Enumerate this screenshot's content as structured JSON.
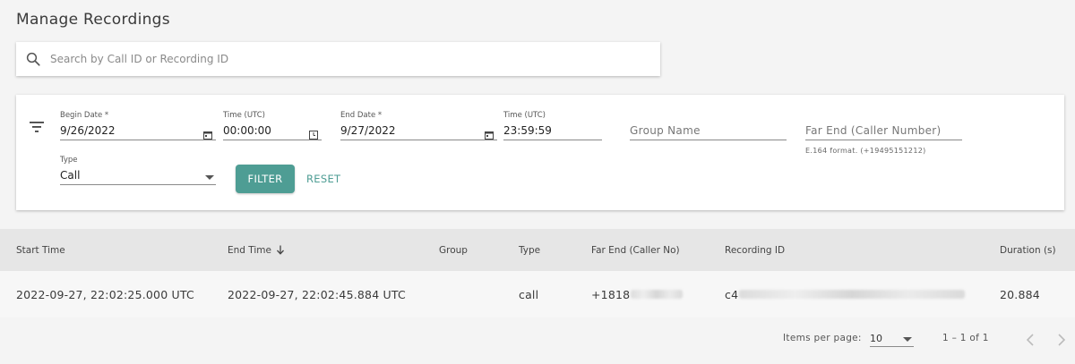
{
  "page": {
    "title": "Manage Recordings"
  },
  "search": {
    "placeholder": "Search by Call ID or Recording ID",
    "value": ""
  },
  "filters": {
    "begin_date": {
      "label": "Begin Date *",
      "value": "9/26/2022"
    },
    "begin_time": {
      "label": "Time (UTC)",
      "value": "00:00:00"
    },
    "end_date": {
      "label": "End Date *",
      "value": "9/27/2022"
    },
    "end_time": {
      "label": "Time (UTC)",
      "value": "23:59:59"
    },
    "group_name": {
      "placeholder": "Group Name",
      "value": ""
    },
    "far_end": {
      "placeholder": "Far End (Caller Number)",
      "hint": "E.164 format. (+19495151212)",
      "value": ""
    },
    "type": {
      "label": "Type",
      "value": "Call"
    },
    "filter_label": "FILTER",
    "reset_label": "RESET"
  },
  "table": {
    "columns": [
      "Start Time",
      "End Time",
      "Group",
      "Type",
      "Far End (Caller No)",
      "Recording ID",
      "Duration (s)"
    ],
    "sort": {
      "column": "End Time",
      "direction": "descending"
    },
    "rows": [
      {
        "start_time": "2022-09-27, 22:02:25.000 UTC",
        "end_time": "2022-09-27, 22:02:45.884 UTC",
        "group": "",
        "type": "call",
        "far_end": "+1818",
        "recording_id": "c4",
        "duration": "20.884"
      }
    ]
  },
  "paginator": {
    "items_per_page_label": "Items per page:",
    "page_size": "10",
    "range": "1 – 1 of 1"
  },
  "colors": {
    "accent": "#4e9d94",
    "header_bg": "#e6e6e6",
    "page_bg": "#f4f4f4"
  }
}
